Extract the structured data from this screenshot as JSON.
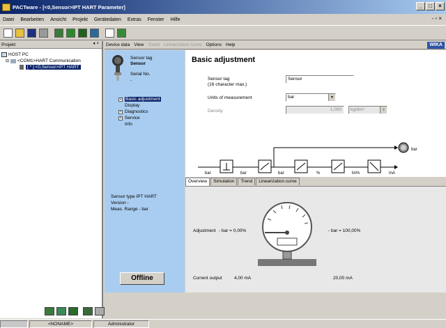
{
  "window": {
    "title": "PACTware - [<0,Sensor>IPT HART Parameter]"
  },
  "menu": [
    "Datei",
    "Bearbeiten",
    "Ansicht",
    "Projekt",
    "Gerätedaten",
    "Extras",
    "Fenster",
    "Hilfe"
  ],
  "project": {
    "title": "Projekt",
    "tree": [
      "HOST PC",
      "<COM1>HART Communication",
      "[ * ] <0,Sensor>IPT HART"
    ]
  },
  "device_toolbar": {
    "items": [
      "Device data",
      "View"
    ],
    "disabled": [
      "Trend",
      "Linearization curve"
    ],
    "items2": [
      "Options",
      "Help"
    ],
    "brand": "WIKA"
  },
  "device": {
    "sensor_tag_label": "Sensor tag",
    "sensor_tag_value": "Sensor",
    "serial_label": "Serial No.",
    "serial_value": "-",
    "menu": [
      "Basic adjustment",
      "Display",
      "Diagnostics",
      "Service",
      "Info"
    ],
    "sensor_type": "Sensor type  IPT HART",
    "version": "Version       -",
    "range": "Meas. Range  -  bar",
    "offline": "Offline"
  },
  "basic": {
    "title": "Basic adjustment",
    "sensor_tag_label": "Sensor tag",
    "sensor_tag_hint": "(16 character max.)",
    "sensor_tag_value": "Sensor",
    "units_label": "Units of measurement",
    "units_value": "bar",
    "density_label": "Density",
    "density_value": "1,000",
    "density_unit": "kg/dm³"
  },
  "chain": {
    "units": [
      "bar",
      "bar",
      "bar",
      "%",
      "lin%",
      "mA"
    ],
    "out_unit": "bar"
  },
  "tabs": [
    "Overview",
    "Simulation",
    "Trend",
    "Linearization curve"
  ],
  "overview": {
    "adjustment_label": "Adjustment",
    "min_label": "- bar = 0,00%",
    "max_label": "- bar = 100,00%",
    "current_label": "Current output",
    "current_min": "4,00 mA",
    "current_max": "20,00 mA"
  },
  "statusbar": {
    "project": "<NONAME>",
    "user": "Administrator"
  }
}
